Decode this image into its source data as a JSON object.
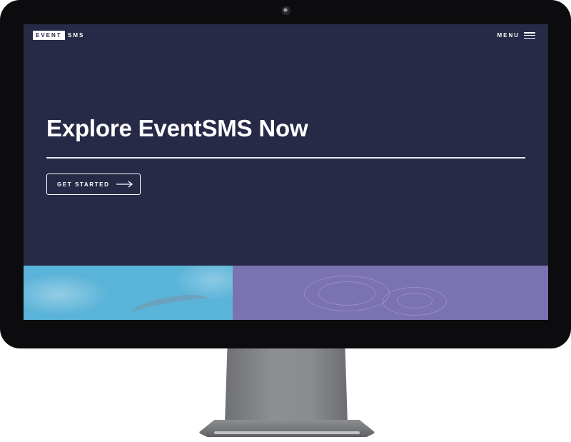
{
  "nav": {
    "logo_boxed": "EVENT",
    "logo_rest": "SMS",
    "menu_label": "MENU"
  },
  "hero": {
    "title": "Explore EventSMS Now",
    "cta_label": "GET STARTED"
  },
  "colors": {
    "screen_bg": "#262a47",
    "tile_left": "#5ab3d8",
    "tile_right": "#7b72b2",
    "bezel": "#0c0c0e"
  },
  "icons": {
    "menu": "hamburger-icon",
    "cta": "arrow-right-icon",
    "camera": "camera-icon"
  }
}
